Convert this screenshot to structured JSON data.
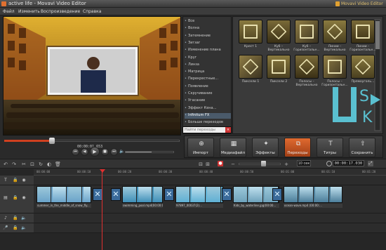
{
  "window": {
    "title": "active life - Movavi Video Editor",
    "brand": "Movavi Video Editor"
  },
  "menu": [
    "Файл",
    "Изменить",
    "Воспроизведение",
    "Справка"
  ],
  "player": {
    "timecode": "00:00:01.653",
    "progress": 0.27,
    "volume": 0.55
  },
  "categories": {
    "items": [
      "Все",
      "Волна",
      "Затемнение",
      "Зигзаг",
      "Изменение плана",
      "Круг",
      "Линза",
      "Матрица",
      "Перекрестные...",
      "Появление",
      "Скручивание",
      "Угасание",
      "Эффект Кена...",
      "Infinitum FX",
      "Больше переходов"
    ],
    "selected": "Infinitum FX",
    "search_placeholder": "Найти переходы"
  },
  "transitions": [
    {
      "label": "Крест 1"
    },
    {
      "label": "Куб – Вертикально"
    },
    {
      "label": "Куб – Горизонтальн..."
    },
    {
      "label": "Линии – Вертикально"
    },
    {
      "label": "Линии – Горизонтальн..."
    },
    {
      "label": "Пиксели 1"
    },
    {
      "label": "Пиксели 2"
    },
    {
      "label": "Полосы – Вертикально"
    },
    {
      "label": "Полосы – Горизонтальн..."
    },
    {
      "label": "Прямоуголь..."
    }
  ],
  "toolbar": {
    "buttons": [
      {
        "label": "Импорт",
        "icon": "import-icon"
      },
      {
        "label": "Медиафайл",
        "icon": "media-icon"
      },
      {
        "label": "Эффекты",
        "icon": "effects-icon"
      },
      {
        "label": "Переходы",
        "icon": "transitions-icon"
      },
      {
        "label": "Титры",
        "icon": "titles-icon"
      },
      {
        "label": "Сохранить",
        "icon": "save-icon"
      }
    ],
    "active": "Переходы"
  },
  "timeline": {
    "zoom": "10 сек",
    "time": "00:00:17.030",
    "ruler": [
      "00:00:00",
      "00:00:10",
      "00:00:20",
      "00:00:30",
      "00:00:40",
      "00:00:50",
      "00:01:00",
      "00:01:10",
      "00:01:20"
    ],
    "clips": [
      {
        "name": "summer_in_the_middle_of_snow_fly...",
        "color": "#6aa3c9"
      },
      {
        "name": "swimming_pool.mp4(00:00:02.1...",
        "color": "#3f8fb8"
      },
      {
        "name": "97897_00037(2)...",
        "color": "#5fb0d4"
      },
      {
        "name": "Kids_by_waterline.jpg(00:00...",
        "color": "#6ea2bb"
      },
      {
        "name": "ocean-wave.mp4 (00:00:...",
        "color": "#4c7e9a"
      }
    ]
  }
}
